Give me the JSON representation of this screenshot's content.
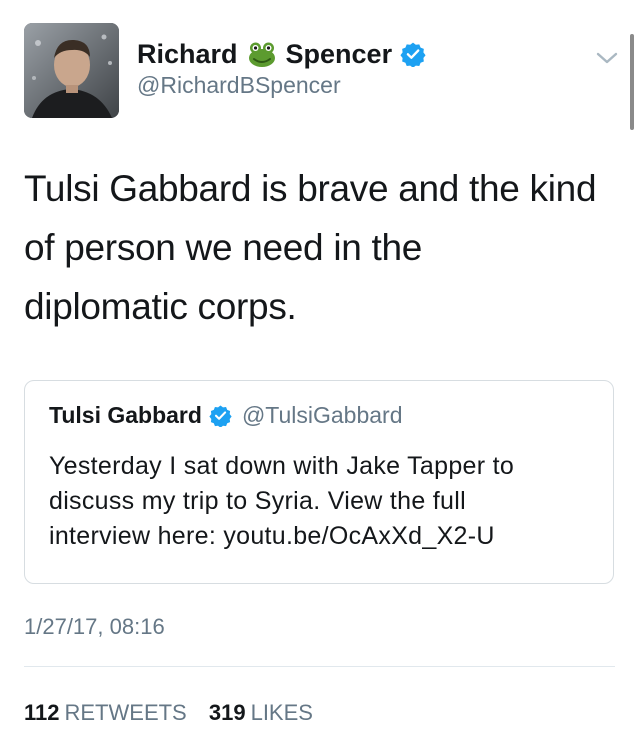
{
  "tweet": {
    "author": {
      "name_first": "Richard",
      "name_emoji_icon": "frog-icon",
      "name_last": "Spencer",
      "verified": true,
      "handle": "@RichardBSpencer"
    },
    "text_lines": [
      "Tulsi Gabbard is brave and the kind",
      "of person we need in the",
      "diplomatic corps."
    ],
    "quoted": {
      "name": "Tulsi Gabbard",
      "verified": true,
      "handle": "@TulsiGabbard",
      "text_lines": [
        "Yesterday I sat down with Jake Tapper to",
        "discuss my trip to Syria. View the full",
        "interview here: youtu.be/OcAxXd_X2-U"
      ]
    },
    "timestamp": "1/27/17, 08:16",
    "stats": {
      "retweets_count": "112",
      "retweets_label": "RETWEETS",
      "likes_count": "319",
      "likes_label": "LIKES"
    }
  },
  "colors": {
    "verified_blue": "#1da1f2",
    "secondary_text": "#657786",
    "primary_text": "#14171a",
    "border": "#d7dde1"
  },
  "icons": [
    "frog-icon",
    "verified-icon",
    "chevron-down-icon"
  ]
}
